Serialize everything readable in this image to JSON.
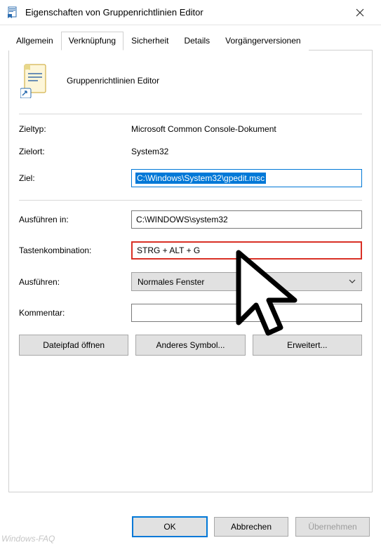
{
  "window": {
    "title": "Eigenschaften von Gruppenrichtlinien Editor"
  },
  "tabs": {
    "general": "Allgemein",
    "shortcut": "Verknüpfung",
    "security": "Sicherheit",
    "details": "Details",
    "previous": "Vorgängerversionen"
  },
  "header": {
    "app_name": "Gruppenrichtlinien Editor"
  },
  "fields": {
    "target_type_label": "Zieltyp:",
    "target_type_value": "Microsoft Common Console-Dokument",
    "target_location_label": "Zielort:",
    "target_location_value": "System32",
    "target_label": "Ziel:",
    "target_value": "C:\\Windows\\System32\\gpedit.msc",
    "start_in_label": "Ausführen in:",
    "start_in_value": "C:\\WINDOWS\\system32",
    "shortcut_key_label": "Tastenkombination:",
    "shortcut_key_value": "STRG + ALT + G",
    "run_label": "Ausführen:",
    "run_value": "Normales Fenster",
    "comment_label": "Kommentar:",
    "comment_value": ""
  },
  "buttons": {
    "open_file_location": "Dateipfad öffnen",
    "change_icon": "Anderes Symbol...",
    "advanced": "Erweitert...",
    "ok": "OK",
    "cancel": "Abbrechen",
    "apply": "Übernehmen"
  },
  "watermark": "Windows-FAQ"
}
